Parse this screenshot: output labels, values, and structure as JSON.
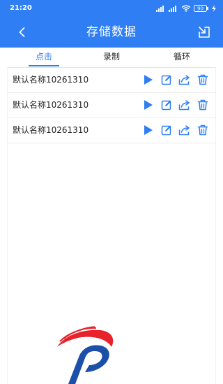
{
  "status_bar": {
    "time": "21:20",
    "battery": "90"
  },
  "app_bar": {
    "title": "存储数据",
    "back_icon": "chevron-left-icon",
    "import_icon": "import-box-icon"
  },
  "tabs": [
    {
      "label": "点击",
      "active": true
    },
    {
      "label": "录制",
      "active": false
    },
    {
      "label": "循环",
      "active": false
    }
  ],
  "items": [
    {
      "name": "默认名称10261310"
    },
    {
      "name": "默认名称10261310"
    },
    {
      "name": "默认名称10261310"
    }
  ],
  "item_actions": [
    "play-icon",
    "edit-icon",
    "share-icon",
    "delete-icon"
  ],
  "colors": {
    "primary": "#2f7ef3",
    "logo_red": "#e8212b",
    "logo_blue": "#1b4fa8"
  }
}
